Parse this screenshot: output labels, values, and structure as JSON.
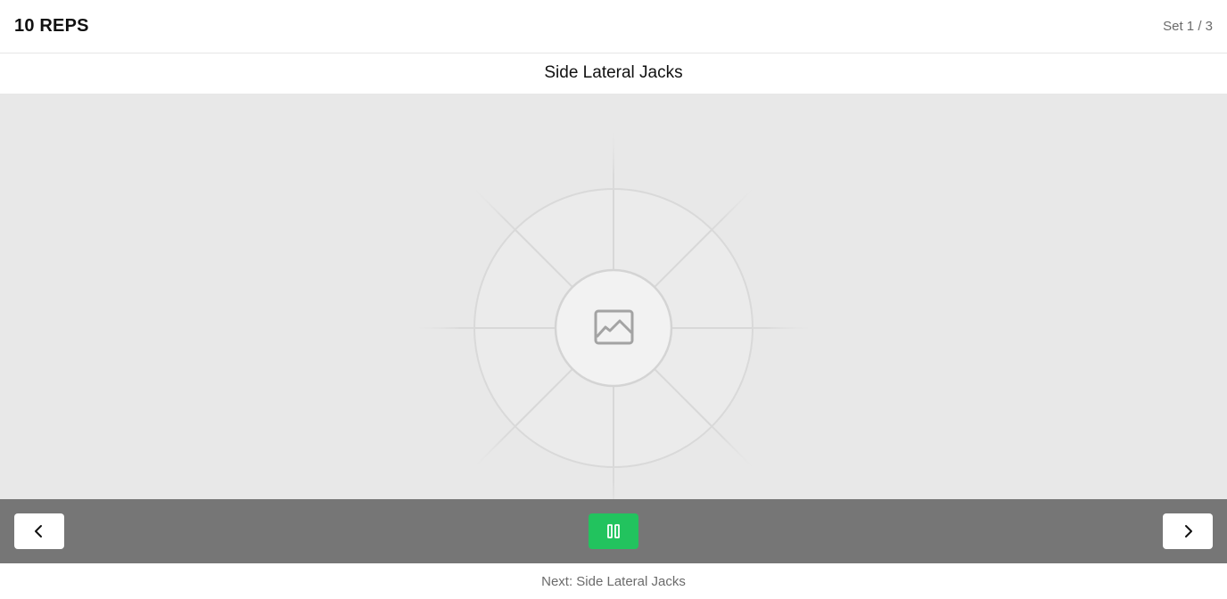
{
  "header": {
    "reps_label": "10 REPS",
    "set_label": "Set 1 / 3"
  },
  "exercise": {
    "title": "Side Lateral Jacks",
    "media_placeholder_icon": "image-icon"
  },
  "controls": {
    "prev_icon": "chevron-left-icon",
    "pause_icon": "pause-icon",
    "next_icon": "chevron-right-icon",
    "pause_color": "#22c35e"
  },
  "footer": {
    "next_label": "Next: Side Lateral Jacks"
  }
}
